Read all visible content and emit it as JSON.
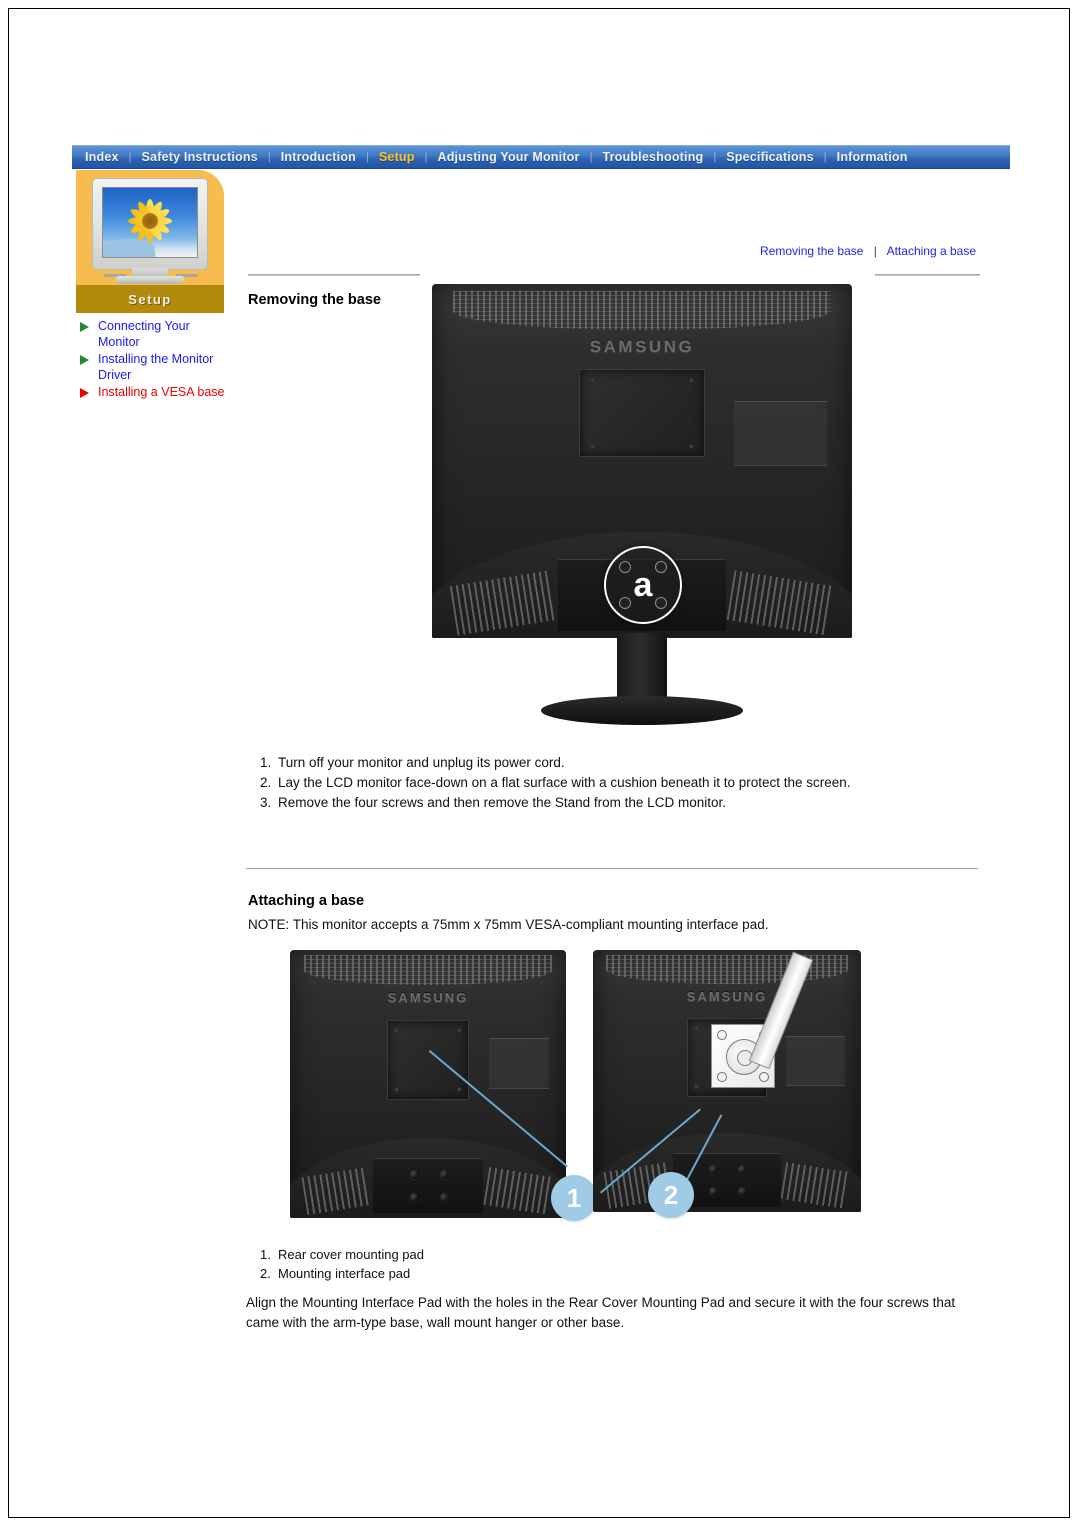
{
  "navbar": {
    "separator": "|",
    "items": [
      {
        "label": "Index",
        "active": false
      },
      {
        "label": "Safety Instructions",
        "active": false
      },
      {
        "label": "Introduction",
        "active": false
      },
      {
        "label": "Setup",
        "active": true
      },
      {
        "label": "Adjusting Your Monitor",
        "active": false
      },
      {
        "label": "Troubleshooting",
        "active": false
      },
      {
        "label": "Specifications",
        "active": false
      },
      {
        "label": "Information",
        "active": false
      }
    ]
  },
  "sidebar": {
    "banner_label": "Setup",
    "thumbnail_name": "crt-monitor-sunflower-thumbnail",
    "links": [
      {
        "label": "Connecting Your Monitor",
        "current": false
      },
      {
        "label": "Installing the Monitor Driver",
        "current": false
      },
      {
        "label": "Installing a VESA base",
        "current": true
      }
    ]
  },
  "breadcrumbs": {
    "first": "Removing the base",
    "divider": "|",
    "second": "Attaching a base"
  },
  "sections": {
    "removing": {
      "heading": "Removing the base",
      "figure_callout": "a",
      "steps": [
        {
          "num": "1.",
          "text": "Turn off your monitor and unplug its power cord."
        },
        {
          "num": "2.",
          "text": "Lay the LCD monitor face-down on a flat surface with a cushion beneath it to protect the screen."
        },
        {
          "num": "3.",
          "text": "Remove the four screws and then remove the Stand from the LCD monitor."
        }
      ]
    },
    "attaching": {
      "heading": "Attaching a base",
      "note": "NOTE: This monitor accepts a 75mm x 75mm VESA-compliant mounting interface pad.",
      "figure_callouts": [
        "1",
        "2"
      ],
      "legend": [
        {
          "num": "1.",
          "text": "Rear cover mounting pad"
        },
        {
          "num": "2.",
          "text": "Mounting interface pad"
        }
      ],
      "paragraph": "Align the Mounting Interface Pad with the holes in the Rear Cover Mounting Pad and secure it with the four screws that came with the arm-type base, wall mount hanger or other base."
    }
  },
  "figures": {
    "monitor_brand": "SAMSUNG"
  },
  "colors": {
    "nav_blue": "#2f63b2",
    "nav_active_text": "#ffc423",
    "sidebar_yellow": "#f7bc50",
    "sidebar_banner": "#b38b0c",
    "link_blue": "#1a1af0",
    "link_current_red": "#ee0000",
    "callout_blue": "#9fcbe6"
  }
}
